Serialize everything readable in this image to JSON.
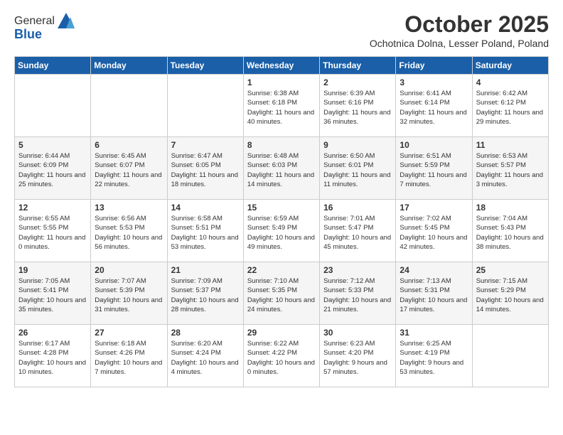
{
  "header": {
    "logo_general": "General",
    "logo_blue": "Blue",
    "title": "October 2025",
    "subtitle": "Ochotnica Dolna, Lesser Poland, Poland"
  },
  "days_of_week": [
    "Sunday",
    "Monday",
    "Tuesday",
    "Wednesday",
    "Thursday",
    "Friday",
    "Saturday"
  ],
  "weeks": [
    [
      {
        "day": "",
        "info": ""
      },
      {
        "day": "",
        "info": ""
      },
      {
        "day": "",
        "info": ""
      },
      {
        "day": "1",
        "info": "Sunrise: 6:38 AM\nSunset: 6:18 PM\nDaylight: 11 hours\nand 40 minutes."
      },
      {
        "day": "2",
        "info": "Sunrise: 6:39 AM\nSunset: 6:16 PM\nDaylight: 11 hours\nand 36 minutes."
      },
      {
        "day": "3",
        "info": "Sunrise: 6:41 AM\nSunset: 6:14 PM\nDaylight: 11 hours\nand 32 minutes."
      },
      {
        "day": "4",
        "info": "Sunrise: 6:42 AM\nSunset: 6:12 PM\nDaylight: 11 hours\nand 29 minutes."
      }
    ],
    [
      {
        "day": "5",
        "info": "Sunrise: 6:44 AM\nSunset: 6:09 PM\nDaylight: 11 hours\nand 25 minutes."
      },
      {
        "day": "6",
        "info": "Sunrise: 6:45 AM\nSunset: 6:07 PM\nDaylight: 11 hours\nand 22 minutes."
      },
      {
        "day": "7",
        "info": "Sunrise: 6:47 AM\nSunset: 6:05 PM\nDaylight: 11 hours\nand 18 minutes."
      },
      {
        "day": "8",
        "info": "Sunrise: 6:48 AM\nSunset: 6:03 PM\nDaylight: 11 hours\nand 14 minutes."
      },
      {
        "day": "9",
        "info": "Sunrise: 6:50 AM\nSunset: 6:01 PM\nDaylight: 11 hours\nand 11 minutes."
      },
      {
        "day": "10",
        "info": "Sunrise: 6:51 AM\nSunset: 5:59 PM\nDaylight: 11 hours\nand 7 minutes."
      },
      {
        "day": "11",
        "info": "Sunrise: 6:53 AM\nSunset: 5:57 PM\nDaylight: 11 hours\nand 3 minutes."
      }
    ],
    [
      {
        "day": "12",
        "info": "Sunrise: 6:55 AM\nSunset: 5:55 PM\nDaylight: 11 hours\nand 0 minutes."
      },
      {
        "day": "13",
        "info": "Sunrise: 6:56 AM\nSunset: 5:53 PM\nDaylight: 10 hours\nand 56 minutes."
      },
      {
        "day": "14",
        "info": "Sunrise: 6:58 AM\nSunset: 5:51 PM\nDaylight: 10 hours\nand 53 minutes."
      },
      {
        "day": "15",
        "info": "Sunrise: 6:59 AM\nSunset: 5:49 PM\nDaylight: 10 hours\nand 49 minutes."
      },
      {
        "day": "16",
        "info": "Sunrise: 7:01 AM\nSunset: 5:47 PM\nDaylight: 10 hours\nand 45 minutes."
      },
      {
        "day": "17",
        "info": "Sunrise: 7:02 AM\nSunset: 5:45 PM\nDaylight: 10 hours\nand 42 minutes."
      },
      {
        "day": "18",
        "info": "Sunrise: 7:04 AM\nSunset: 5:43 PM\nDaylight: 10 hours\nand 38 minutes."
      }
    ],
    [
      {
        "day": "19",
        "info": "Sunrise: 7:05 AM\nSunset: 5:41 PM\nDaylight: 10 hours\nand 35 minutes."
      },
      {
        "day": "20",
        "info": "Sunrise: 7:07 AM\nSunset: 5:39 PM\nDaylight: 10 hours\nand 31 minutes."
      },
      {
        "day": "21",
        "info": "Sunrise: 7:09 AM\nSunset: 5:37 PM\nDaylight: 10 hours\nand 28 minutes."
      },
      {
        "day": "22",
        "info": "Sunrise: 7:10 AM\nSunset: 5:35 PM\nDaylight: 10 hours\nand 24 minutes."
      },
      {
        "day": "23",
        "info": "Sunrise: 7:12 AM\nSunset: 5:33 PM\nDaylight: 10 hours\nand 21 minutes."
      },
      {
        "day": "24",
        "info": "Sunrise: 7:13 AM\nSunset: 5:31 PM\nDaylight: 10 hours\nand 17 minutes."
      },
      {
        "day": "25",
        "info": "Sunrise: 7:15 AM\nSunset: 5:29 PM\nDaylight: 10 hours\nand 14 minutes."
      }
    ],
    [
      {
        "day": "26",
        "info": "Sunrise: 6:17 AM\nSunset: 4:28 PM\nDaylight: 10 hours\nand 10 minutes."
      },
      {
        "day": "27",
        "info": "Sunrise: 6:18 AM\nSunset: 4:26 PM\nDaylight: 10 hours\nand 7 minutes."
      },
      {
        "day": "28",
        "info": "Sunrise: 6:20 AM\nSunset: 4:24 PM\nDaylight: 10 hours\nand 4 minutes."
      },
      {
        "day": "29",
        "info": "Sunrise: 6:22 AM\nSunset: 4:22 PM\nDaylight: 10 hours\nand 0 minutes."
      },
      {
        "day": "30",
        "info": "Sunrise: 6:23 AM\nSunset: 4:20 PM\nDaylight: 9 hours\nand 57 minutes."
      },
      {
        "day": "31",
        "info": "Sunrise: 6:25 AM\nSunset: 4:19 PM\nDaylight: 9 hours\nand 53 minutes."
      },
      {
        "day": "",
        "info": ""
      }
    ]
  ]
}
